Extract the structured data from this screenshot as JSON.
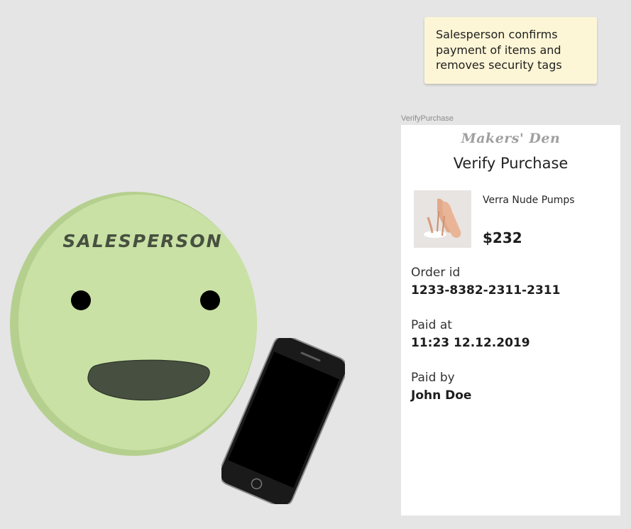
{
  "note": {
    "lines": [
      "Salesperson confirms",
      "payment of items and",
      "removes security tags"
    ]
  },
  "frame": {
    "label": "VerifyPurchase"
  },
  "screen": {
    "brand": "Makers' Den",
    "title": "Verify Purchase",
    "product": {
      "name": "Verra Nude Pumps",
      "price": "$232"
    },
    "fields": [
      {
        "label": "Order id",
        "value": "1233-8382-2311-2311"
      },
      {
        "label": "Paid at",
        "value": "11:23 12.12.2019"
      },
      {
        "label": "Paid by",
        "value": "John Doe"
      }
    ]
  },
  "persona": {
    "label": "SALESPERSON",
    "face_color": "#c9e1a5",
    "ink_color": "#475040"
  }
}
